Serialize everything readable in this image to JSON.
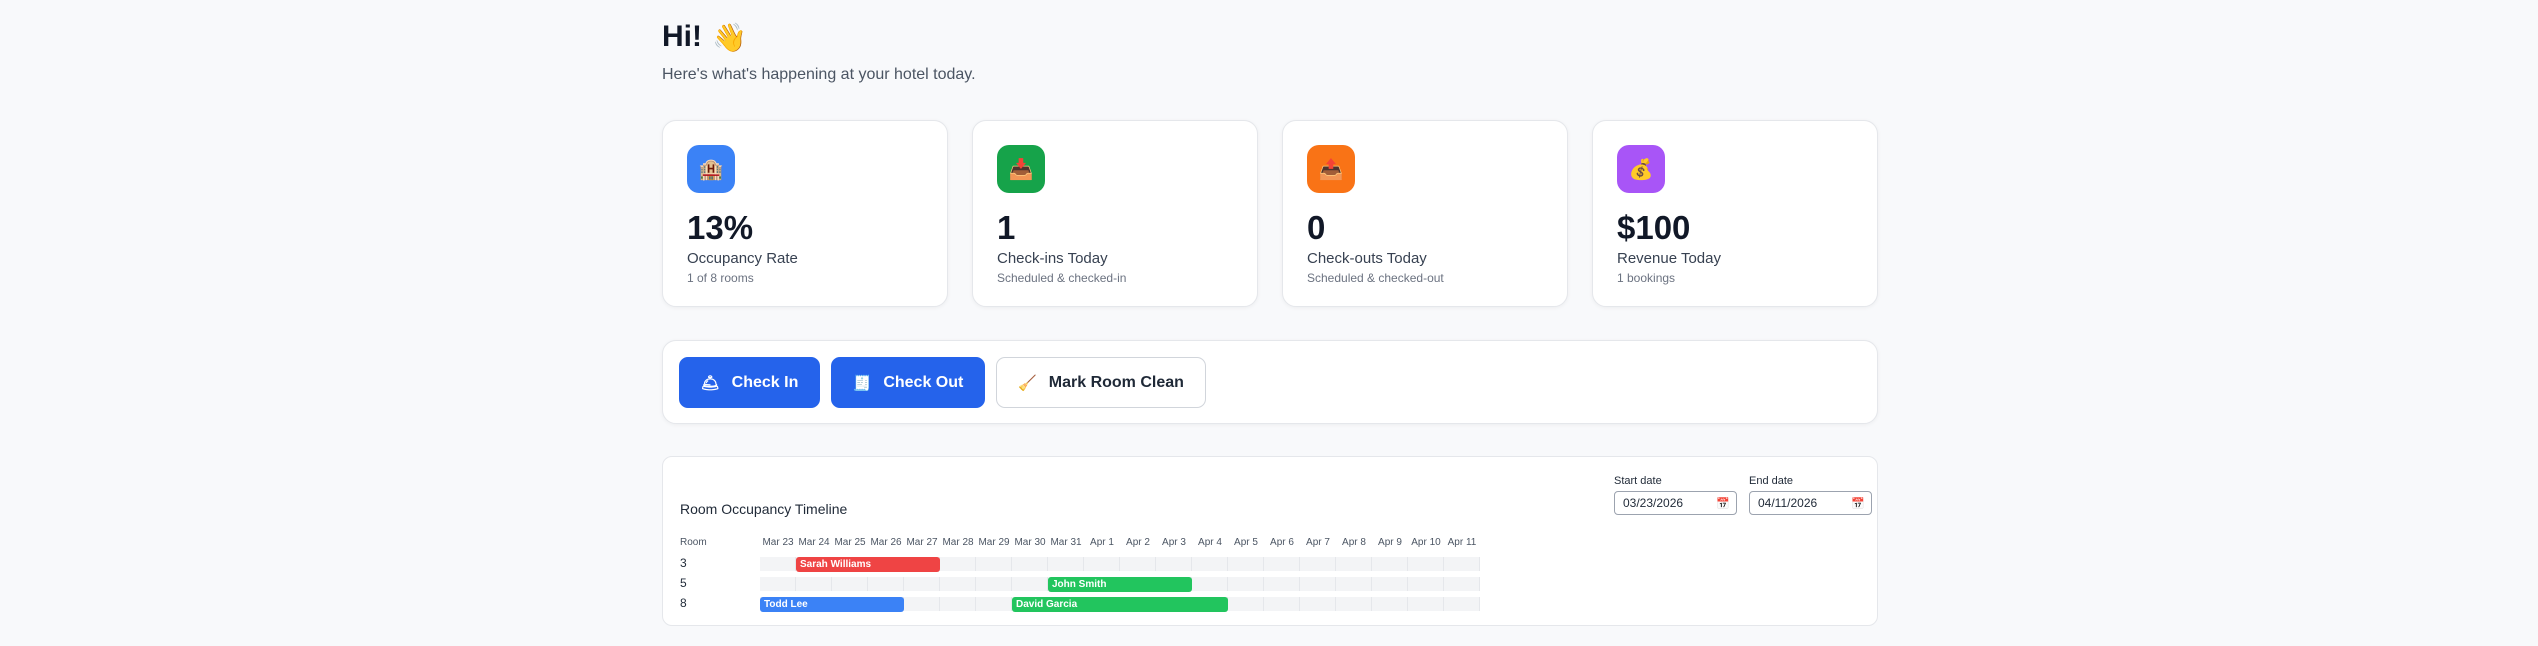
{
  "header": {
    "greeting": "Hi!",
    "wave_icon": "waving-hand-icon",
    "subtitle": "Here's what's happening at your hotel today."
  },
  "stats": [
    {
      "value": "13%",
      "label": "Occupancy Rate",
      "detail": "1 of 8 rooms",
      "icon": "hotel-icon",
      "color": "#3b82f6"
    },
    {
      "value": "1",
      "label": "Check-ins Today",
      "detail": "Scheduled & checked-in",
      "icon": "inbox-tray-icon",
      "color": "#22c55e"
    },
    {
      "value": "0",
      "label": "Check-outs Today",
      "detail": "Scheduled & checked-out",
      "icon": "outbox-tray-icon",
      "color": "#f97316"
    },
    {
      "value": "$100",
      "label": "Revenue Today",
      "detail": "1 bookings",
      "icon": "money-bag-icon",
      "color": "#a855f7"
    }
  ],
  "actions": {
    "check_in": "Check In",
    "check_out": "Check Out",
    "mark_clean": "Mark Room Clean"
  },
  "timeline": {
    "title": "Room Occupancy Timeline",
    "start_label": "Start date",
    "start_value": "03/23/2026",
    "end_label": "End date",
    "end_value": "04/11/2026",
    "room_header": "Room",
    "dates": [
      "Mar 23",
      "Mar 24",
      "Mar 25",
      "Mar 26",
      "Mar 27",
      "Mar 28",
      "Mar 29",
      "Mar 30",
      "Mar 31",
      "Apr 1",
      "Apr 2",
      "Apr 3",
      "Apr 4",
      "Apr 5",
      "Apr 6",
      "Apr 7",
      "Apr 8",
      "Apr 9",
      "Apr 10",
      "Apr 11"
    ],
    "rooms": [
      "3",
      "5",
      "8"
    ],
    "bookings": [
      {
        "room": "3",
        "guest": "Sarah Williams",
        "start": "Mar 24",
        "end": "Mar 28",
        "color": "#ef4444"
      },
      {
        "room": "5",
        "guest": "John Smith",
        "start": "Mar 31",
        "end": "Apr 4",
        "color": "#22c55e"
      },
      {
        "room": "8",
        "guest": "Todd Lee",
        "start": "Mar 23",
        "end": "Mar 27",
        "color": "#3b82f6"
      },
      {
        "room": "8",
        "guest": "David Garcia",
        "start": "Mar 30",
        "end": "Apr 5",
        "color": "#22c55e"
      }
    ]
  }
}
